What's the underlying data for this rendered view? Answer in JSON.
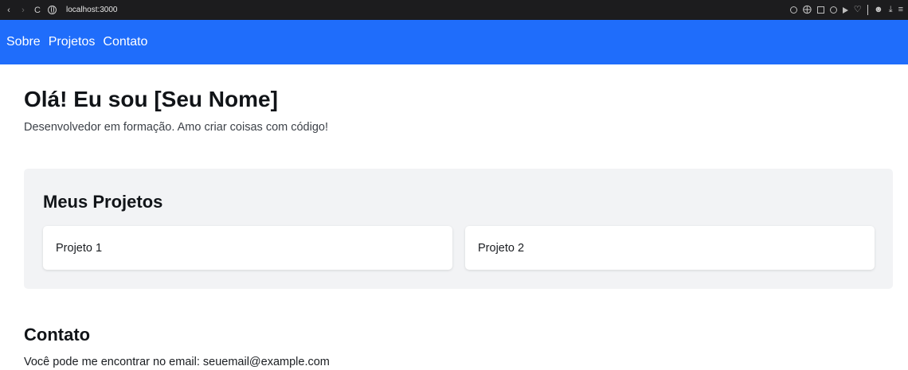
{
  "browser": {
    "url": "localhost:3000",
    "icons": [
      "back-icon",
      "forward-icon",
      "reload-icon",
      "site-info-icon",
      "zoom-icon",
      "extensions-icon",
      "sidebar-icon",
      "shield-icon",
      "play-icon",
      "heart-icon",
      "profile-icon",
      "download-icon",
      "menu-icon"
    ]
  },
  "nav": {
    "links": [
      "Sobre",
      "Projetos",
      "Contato"
    ],
    "background": "#1f6dfb"
  },
  "hero": {
    "title": "Olá! Eu sou [Seu Nome]",
    "subtitle": "Desenvolvedor em formação. Amo criar coisas com código!"
  },
  "projects": {
    "title": "Meus Projetos",
    "items": [
      "Projeto 1",
      "Projeto 2"
    ]
  },
  "contact": {
    "title": "Contato",
    "text": "Você pode me encontrar no email: seuemail@example.com"
  }
}
